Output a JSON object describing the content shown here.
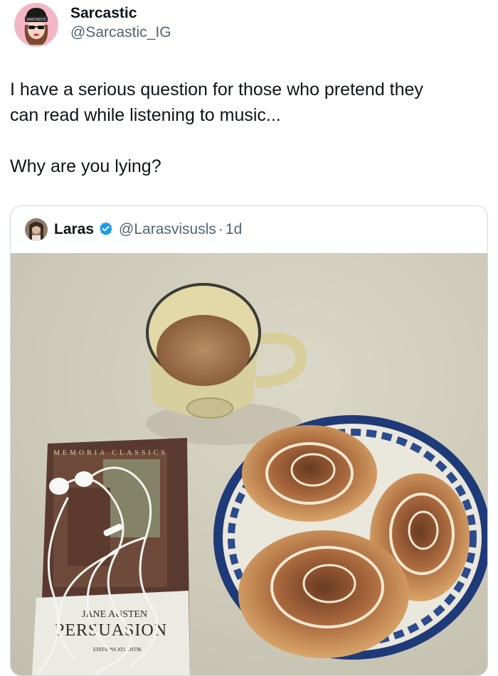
{
  "author": {
    "display_name": "Sarcastic",
    "handle": "@Sarcastic_IG",
    "avatar_icon": "sarcastic-avatar",
    "beanie_text": "SARCASTIC"
  },
  "tweet": {
    "line1": "I have a serious question for those who pretend they",
    "line2": "can read while listening to music...",
    "line3": "Why are you lying?"
  },
  "quote": {
    "display_name": "Laras",
    "verified_icon": "verified-badge-icon",
    "handle": "@Larasvisusls",
    "separator": "·",
    "time": "1d",
    "photo": {
      "book_series": "MEMORIA CLASSICS",
      "book_author": "JANE AUSTEN",
      "book_title": "PERSUASION",
      "book_publisher": "EDITIONS ATLANTIK"
    }
  },
  "colors": {
    "text": "#0f1419",
    "secondary": "#536471",
    "border": "#cfd9de",
    "verified": "#1d9bf0",
    "avatar_bg": "#f4b6c7"
  }
}
